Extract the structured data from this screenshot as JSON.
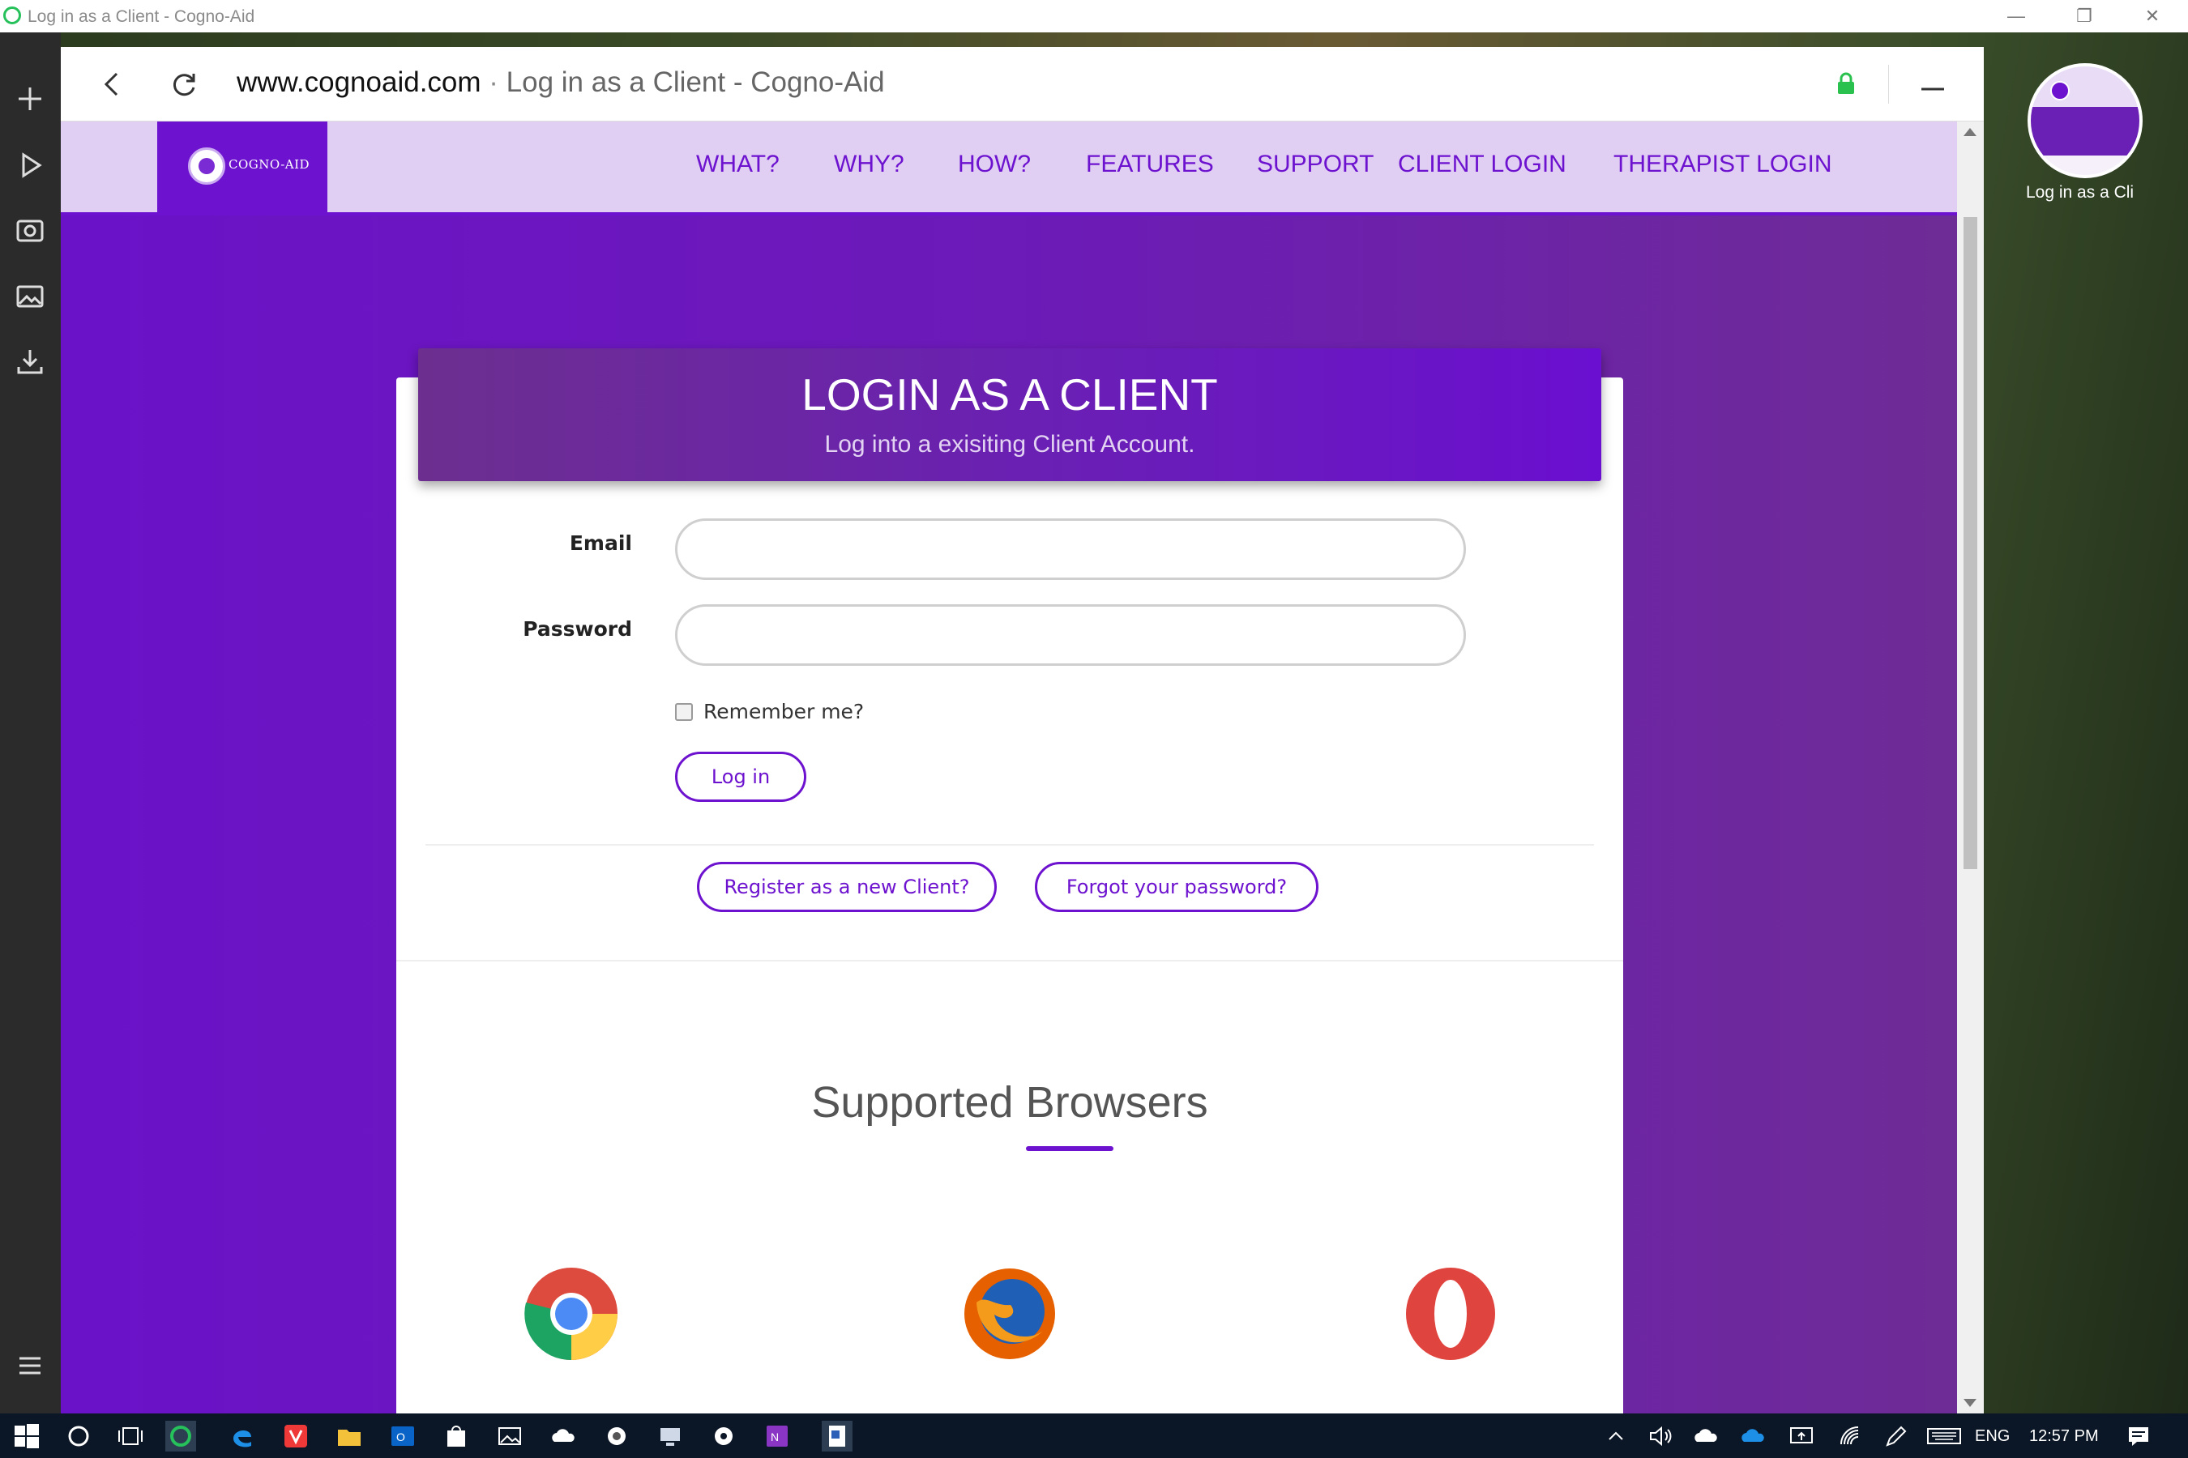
{
  "window": {
    "title": "Log in as a Client - Cogno-Aid"
  },
  "rail": {
    "buttons": [
      "new-tab",
      "play",
      "camera",
      "image",
      "download",
      "menu"
    ]
  },
  "address_bar": {
    "domain": "www.cognoaid.com",
    "separator": " · ",
    "page_title": "Log in as a Client - Cogno-Aid"
  },
  "site": {
    "logo_text": "COGNO-AID",
    "nav": [
      "WHAT?",
      "WHY?",
      "HOW?",
      "FEATURES",
      "SUPPORT",
      "CLIENT LOGIN",
      "THERAPIST LOGIN"
    ]
  },
  "login": {
    "title": "LOGIN AS A CLIENT",
    "subtitle": "Log into a exisiting Client Account.",
    "email_label": "Email",
    "email_value": "",
    "password_label": "Password",
    "password_value": "",
    "remember_label": "Remember me?",
    "login_button": "Log in",
    "register_button": "Register as a new Client?",
    "forgot_button": "Forgot your password?"
  },
  "supported": {
    "title": "Supported Browsers",
    "browsers": [
      "chrome",
      "firefox",
      "opera"
    ]
  },
  "tab_preview": {
    "label": "Log in as a Cli"
  },
  "taskbar": {
    "language": "ENG",
    "time": "12:57 PM"
  },
  "colors": {
    "brand": "#6d12cf",
    "nav_bg": "#e0cff3",
    "taskbar": "#0b1626"
  }
}
